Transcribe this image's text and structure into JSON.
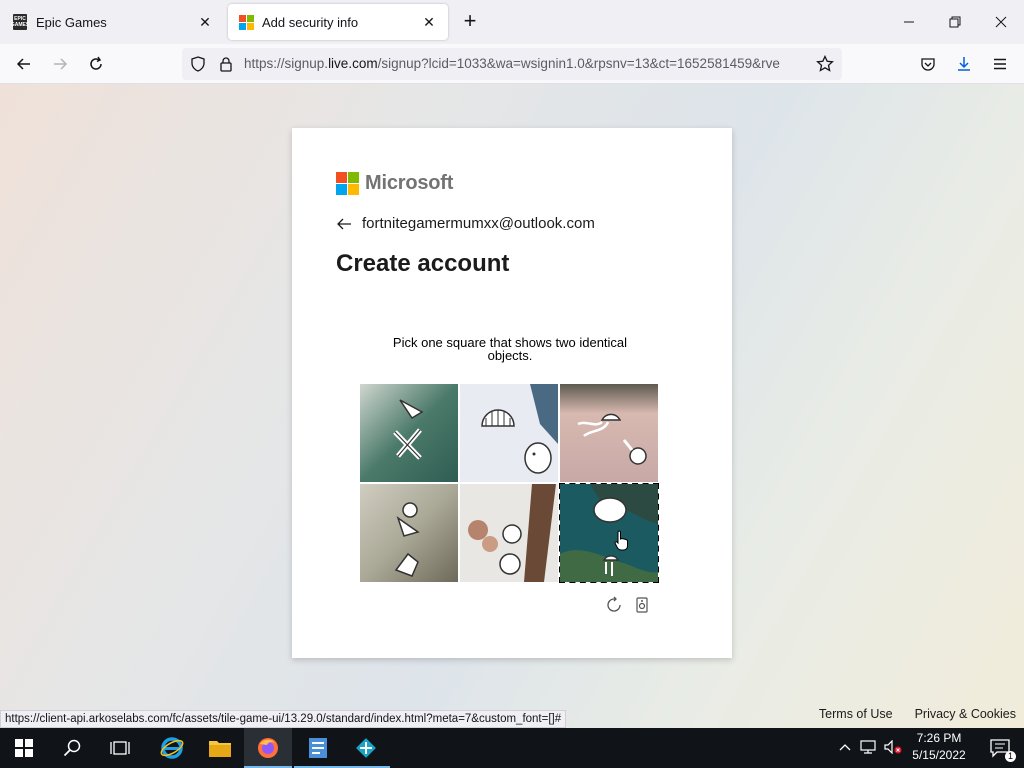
{
  "browser": {
    "tabs": [
      {
        "title": "Epic Games",
        "favicon_text": "EPIC GAMES"
      },
      {
        "title": "Add security info"
      }
    ],
    "url_prefix": "https://signup.",
    "url_domain": "live.com",
    "url_rest": "/signup?lcid=1033&wa=wsignin1.0&rpsnv=13&ct=1652581459&rve",
    "status_url": "https://client-api.arkoselabs.com/fc/assets/tile-game-ui/13.29.0/standard/index.html?meta=7&custom_font=[]#"
  },
  "page": {
    "brand": "Microsoft",
    "email": "fortnitegamermumxx@outlook.com",
    "heading": "Create account",
    "prompt": "Pick one square that shows two identical objects.",
    "tiles": [
      {
        "label": "tile-1",
        "selected": false
      },
      {
        "label": "tile-2",
        "selected": false
      },
      {
        "label": "tile-3",
        "selected": false
      },
      {
        "label": "tile-4",
        "selected": false
      },
      {
        "label": "tile-5",
        "selected": false
      },
      {
        "label": "tile-6",
        "selected": true
      }
    ]
  },
  "footer": {
    "terms": "Terms of Use",
    "privacy": "Privacy & Cookies"
  },
  "taskbar": {
    "time": "7:26 PM",
    "date": "5/15/2022",
    "notification_count": "1"
  },
  "colors": {
    "ms_red": "#f25022",
    "ms_green": "#7fba00",
    "ms_blue": "#00a4ef",
    "ms_yellow": "#ffb900"
  }
}
